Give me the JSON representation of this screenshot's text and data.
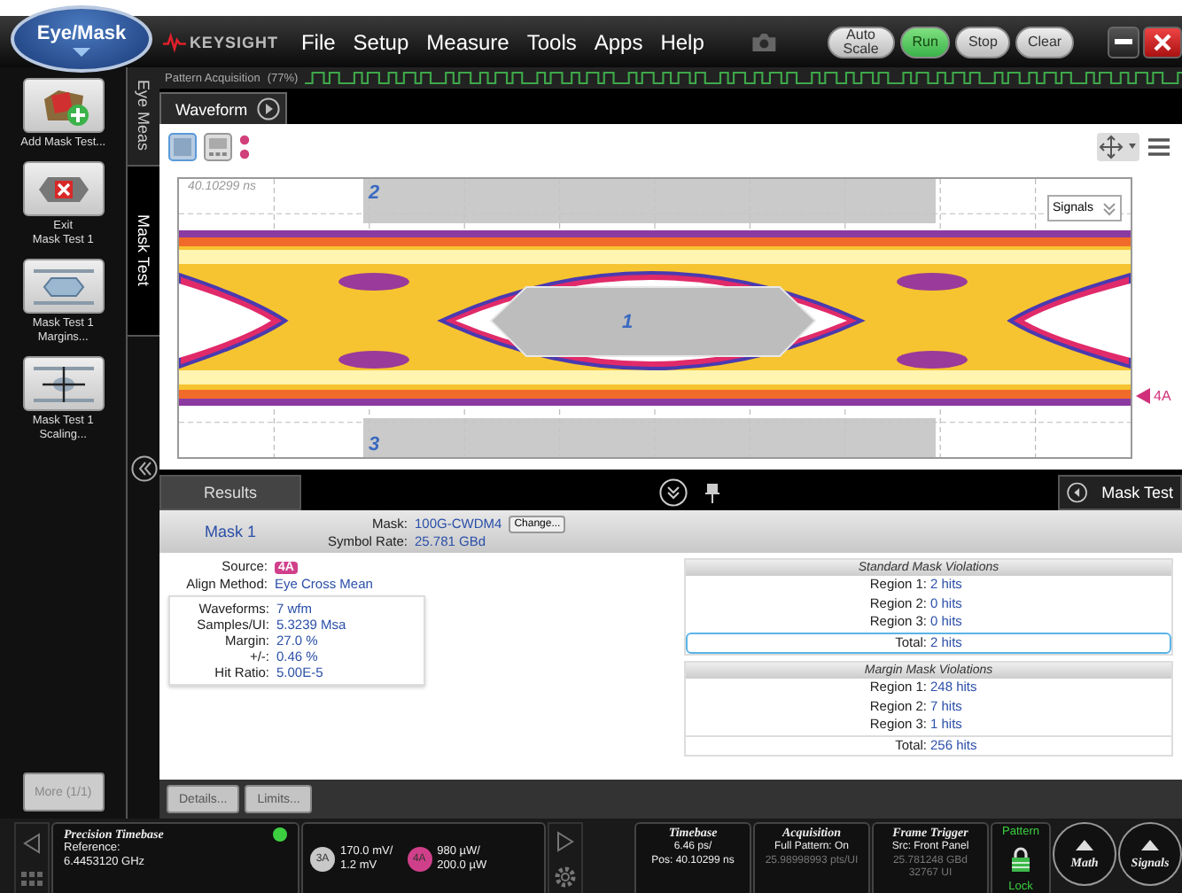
{
  "app_button": "Eye/Mask",
  "brand": "KEYSIGHT",
  "menu": [
    "File",
    "Setup",
    "Measure",
    "Tools",
    "Apps",
    "Help"
  ],
  "run_controls": [
    {
      "label": "Auto Scale",
      "on": false
    },
    {
      "label": "Run",
      "on": true
    },
    {
      "label": "Stop",
      "on": false
    },
    {
      "label": "Clear",
      "on": false
    }
  ],
  "acquisition": {
    "label": "Pattern Acquisition",
    "percent": "(77%)"
  },
  "sidebar": {
    "actions": [
      {
        "kind": "add",
        "lines": [
          "Add Mask Test..."
        ]
      },
      {
        "kind": "exit",
        "lines": [
          "Exit",
          "Mask Test 1"
        ]
      },
      {
        "kind": "margins",
        "lines": [
          "Mask Test 1",
          "Margins..."
        ]
      },
      {
        "kind": "scaling",
        "lines": [
          "Mask Test 1",
          "Scaling..."
        ]
      }
    ],
    "more": "More (1/1)",
    "tabs": [
      {
        "label": "Eye Meas",
        "selected": false
      },
      {
        "label": "Mask Test",
        "selected": true
      }
    ]
  },
  "waveform": {
    "tab": "Waveform",
    "timestamp": "40.10299 ns",
    "signals_menu": "Signals",
    "marker": "4A",
    "regions": [
      {
        "label": "2",
        "kind": "top"
      },
      {
        "label": "1",
        "kind": "center"
      },
      {
        "label": "3",
        "kind": "bottom"
      }
    ]
  },
  "results": {
    "tabs": [
      {
        "label": "Results",
        "selected": true
      }
    ],
    "side_tab": "Mask Test",
    "mask_title": "Mask 1",
    "mask_label": "Mask:",
    "mask_value": "100G-CWDM4",
    "change_button": "Change...",
    "rate_label": "Symbol Rate:",
    "rate_value": "25.781 GBd",
    "source_label": "Source:",
    "source_value": "4A",
    "align_label": "Align Method:",
    "align_value": "Eye Cross Mean",
    "stats": [
      {
        "label": "Waveforms:",
        "value": "7 wfm"
      },
      {
        "label": "Samples/UI:",
        "value": "5.3239 Msa"
      },
      {
        "label": "Margin:",
        "value": "27.0 %"
      },
      {
        "label": "+/-:",
        "value": "0.46 %"
      },
      {
        "label": "Hit Ratio:",
        "value": "5.00E-5"
      }
    ],
    "violation_tables": [
      {
        "title": "Standard Mask Violations",
        "rows": [
          {
            "label": "Region 1:",
            "value": "2 hits"
          },
          {
            "label": "Region 2:",
            "value": "0 hits"
          },
          {
            "label": "Region 3:",
            "value": "0 hits"
          }
        ],
        "total_label": "Total:",
        "total_value": "2 hits",
        "total_selected": true
      },
      {
        "title": "Margin Mask Violations",
        "rows": [
          {
            "label": "Region 1:",
            "value": "248 hits"
          },
          {
            "label": "Region 2:",
            "value": "7 hits"
          },
          {
            "label": "Region 3:",
            "value": "1 hits"
          }
        ],
        "total_label": "Total:",
        "total_value": "256 hits",
        "total_selected": false
      }
    ],
    "buttons": [
      {
        "label": "Details...",
        "disabled": true
      },
      {
        "label": "Limits...",
        "disabled": true
      }
    ]
  },
  "status_bar": {
    "timebase_panel": {
      "title": "Precision Timebase",
      "ok": true,
      "lines": [
        "Reference:",
        "6.4453120 GHz"
      ]
    },
    "channels": [
      {
        "badge": "3A",
        "color": "#c8c8c8",
        "lines": [
          "170.0 mV/",
          "1.2 mV"
        ]
      },
      {
        "badge": "4A",
        "color": "#d0408a",
        "lines": [
          "980 µW/",
          "200.0 µW"
        ]
      }
    ],
    "readouts": [
      {
        "title": "Timebase",
        "lines": [
          {
            "text": "6.46 ps/",
            "dim": false
          },
          {
            "text": "Pos: 40.10299 ns",
            "dim": false
          }
        ]
      },
      {
        "title": "Acquisition",
        "lines": [
          {
            "text": "Full Pattern: On",
            "dim": false
          },
          {
            "text": "25.98998993 pts/UI",
            "dim": true
          }
        ]
      },
      {
        "title": "Frame Trigger",
        "lines": [
          {
            "text": "Src: Front Panel",
            "dim": false
          },
          {
            "text": "25.781248 GBd",
            "dim": true
          },
          {
            "text": "32767 UI",
            "dim": true
          }
        ]
      }
    ],
    "pattern": {
      "title": "Pattern",
      "status": "Lock"
    },
    "circles": [
      "Math",
      "Signals"
    ]
  }
}
